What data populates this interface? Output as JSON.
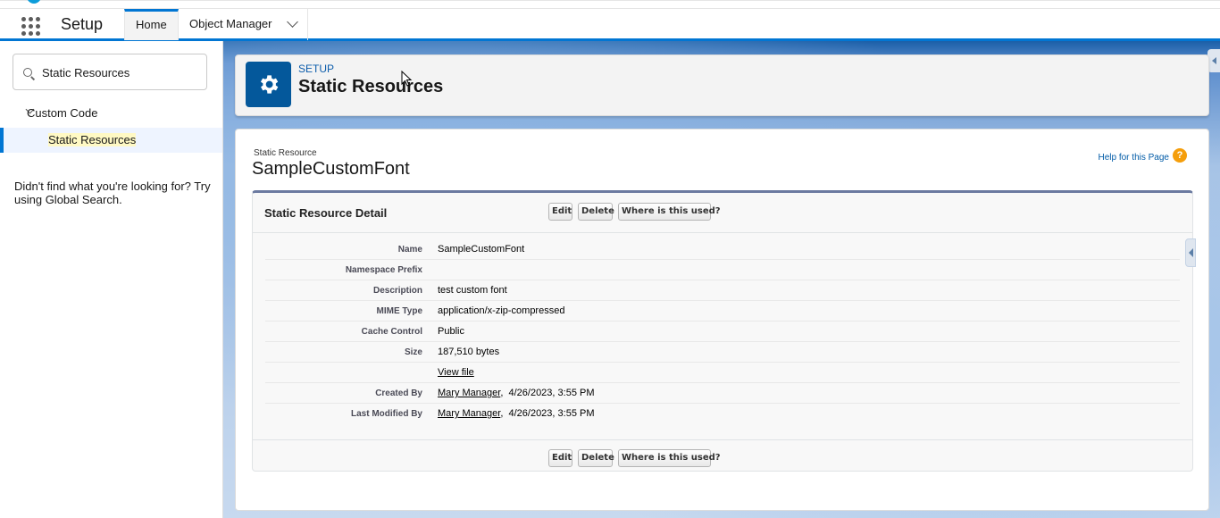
{
  "topbar": {
    "app_name": "Setup",
    "tabs": [
      {
        "label": "Home"
      },
      {
        "label": "Object Manager"
      }
    ]
  },
  "sidebar": {
    "search_value": "Static Resources",
    "group_label": "Custom Code",
    "selected_item": "Static Resources",
    "not_found_text": "Didn't find what you're looking for? Try using Global Search."
  },
  "page_header": {
    "eyebrow": "SETUP",
    "title": "Static Resources"
  },
  "record": {
    "type_label": "Static Resource",
    "name": "SampleCustomFont",
    "help_link": "Help for this Page",
    "help_icon_glyph": "?",
    "section_title": "Static Resource Detail",
    "buttons": {
      "edit": "Edit",
      "delete": "Delete",
      "where_used": "Where is this used?"
    },
    "fields": [
      {
        "label": "Name",
        "value": "SampleCustomFont"
      },
      {
        "label": "Namespace Prefix",
        "value": ""
      },
      {
        "label": "Description",
        "value": "test custom font"
      },
      {
        "label": "MIME Type",
        "value": "application/x-zip-compressed"
      },
      {
        "label": "Cache Control",
        "value": "Public"
      },
      {
        "label": "Size",
        "value": "187,510 bytes"
      },
      {
        "label": "",
        "link": "View file"
      },
      {
        "label": "Created By",
        "link": "Mary Manager",
        "value": ",  4/26/2023, 3:55 PM"
      },
      {
        "label": "Last Modified By",
        "link": "Mary Manager",
        "value": ",  4/26/2023, 3:55 PM"
      }
    ]
  },
  "colors": {
    "brand_blue": "#0176d3",
    "gear_tile": "#04589b",
    "help_icon": "#f59e0b",
    "highlight": "#fff9c4"
  },
  "icons": [
    "app-launcher-icon",
    "chevron-down-icon",
    "search-icon",
    "gear-icon",
    "help-icon",
    "mouse-cursor-icon"
  ]
}
